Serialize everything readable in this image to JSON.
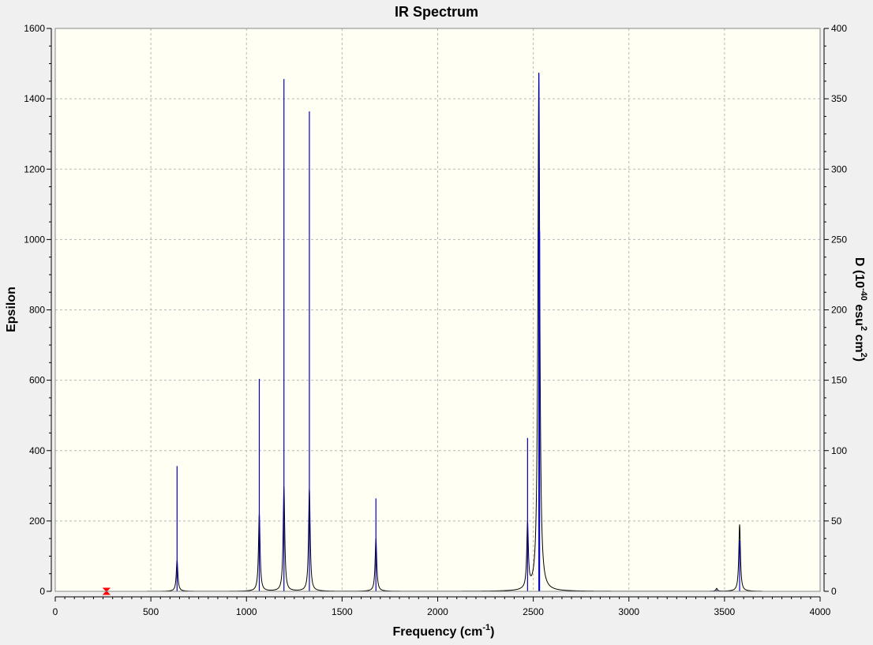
{
  "chart_data": {
    "type": "line",
    "title": "IR Spectrum",
    "xlabel": {
      "pre": "Frequency (cm",
      "sup": "-1",
      "post": ")"
    },
    "ylabel_left": "Epsilon",
    "ylabel_right": {
      "parts": [
        "D (10",
        "-40",
        " esu",
        "2",
        " cm",
        "2",
        ")"
      ]
    },
    "xlim": [
      0,
      4000
    ],
    "ylim_left": [
      0,
      1600
    ],
    "ylim_right": [
      0,
      400
    ],
    "x_ticks": [
      0,
      500,
      1000,
      1500,
      2000,
      2500,
      3000,
      3500,
      4000
    ],
    "x_tick_labels": [
      "0",
      "500",
      "1000",
      "1500",
      "2000",
      "2500",
      "3000",
      "3500",
      "4000"
    ],
    "y_left_ticks": [
      0,
      200,
      400,
      600,
      800,
      1000,
      1200,
      1400,
      1600
    ],
    "y_left_tick_labels": [
      "0",
      "200",
      "400",
      "600",
      "800",
      "1000",
      "1200",
      "1400",
      "1600"
    ],
    "y_right_ticks": [
      0,
      50,
      100,
      150,
      200,
      250,
      300,
      350,
      400
    ],
    "y_right_tick_labels": [
      "0",
      "50",
      "100",
      "150",
      "200",
      "250",
      "300",
      "350",
      "400"
    ],
    "grid": true,
    "series": [
      {
        "kind": "spectrum-curve",
        "color": "#000000",
        "peaks": [
          {
            "x": 637,
            "epsilon": 88,
            "width": 10
          },
          {
            "x": 1067,
            "epsilon": 220,
            "width": 10
          },
          {
            "x": 1196,
            "epsilon": 296,
            "width": 10
          },
          {
            "x": 1329,
            "epsilon": 292,
            "width": 10
          },
          {
            "x": 1677,
            "epsilon": 150,
            "width": 10
          },
          {
            "x": 2470,
            "epsilon": 185,
            "width": 10
          },
          {
            "x": 2529,
            "epsilon": 1473,
            "width": 12
          },
          {
            "x": 3459,
            "epsilon": 8,
            "width": 10
          },
          {
            "x": 3579,
            "epsilon": 190,
            "width": 10
          }
        ]
      },
      {
        "kind": "stick",
        "color": "#0000cc",
        "sticks": [
          {
            "x": 637,
            "d": 89
          },
          {
            "x": 1067,
            "d": 151
          },
          {
            "x": 1196,
            "d": 364
          },
          {
            "x": 1329,
            "d": 341
          },
          {
            "x": 1677,
            "d": 66
          },
          {
            "x": 2470,
            "d": 109
          },
          {
            "x": 2529,
            "d": 368
          },
          {
            "x": 2533,
            "d": 256
          },
          {
            "x": 3459,
            "d": 1
          },
          {
            "x": 3579,
            "d": 36
          }
        ]
      }
    ],
    "marker": {
      "x": 268,
      "epsilon": 0,
      "color": "#ff0000"
    }
  },
  "colors": {
    "plot_bg": "#fffff4",
    "frame_bg": "#f0f0f0",
    "grid": "#b8b8b8",
    "axis": "#000000"
  }
}
